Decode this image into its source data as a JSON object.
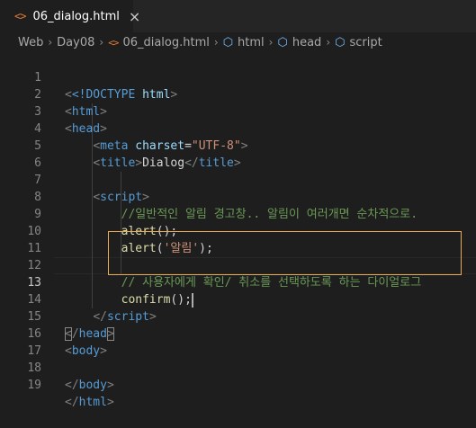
{
  "tab": {
    "icon": "html-file-icon",
    "label": "06_dialog.html",
    "close_glyph": "×"
  },
  "breadcrumb": {
    "items": [
      "Web",
      "Day08",
      "06_dialog.html",
      "html",
      "head",
      "script"
    ],
    "separator": "›"
  },
  "editor": {
    "line_numbers": [
      "1",
      "2",
      "3",
      "4",
      "5",
      "6",
      "7",
      "8",
      "9",
      "10",
      "11",
      "12",
      "13",
      "14",
      "15",
      "16",
      "17",
      "18",
      "19"
    ],
    "active_line": "13",
    "lines": {
      "l1_a": "<!DOCTYPE",
      "l1_b": " html",
      "l1_c": ">",
      "l2": "html",
      "l3": "head",
      "l4_tag": "meta",
      "l4_attr": "charset",
      "l4_val": "\"UTF-8\"",
      "l5_tag": "title",
      "l5_text": "Dialog",
      "l7": "script",
      "l8": "//일반적인 알림 경고창.. 알림이 여러개면 순차적으로.",
      "l9_fn": "alert",
      "l9_p": "();",
      "l10_fn": "alert",
      "l10_p1": "(",
      "l10_str": "'알림'",
      "l10_p2": ");",
      "l12": "// 사용자에게 확인/ 취소를 선택하도록 하는 다이얼로그",
      "l13_fn": "confirm",
      "l13_p": "();",
      "l14": "script",
      "l15": "head",
      "l16": "body",
      "l18": "body",
      "l19": "html"
    }
  },
  "colors": {
    "background": "#1e1e1e",
    "keyword": "#569cd6",
    "attribute": "#9cdcfe",
    "string": "#ce9178",
    "comment": "#6a9955",
    "function": "#dcdcaa",
    "highlight_border": "#e8ab53"
  }
}
